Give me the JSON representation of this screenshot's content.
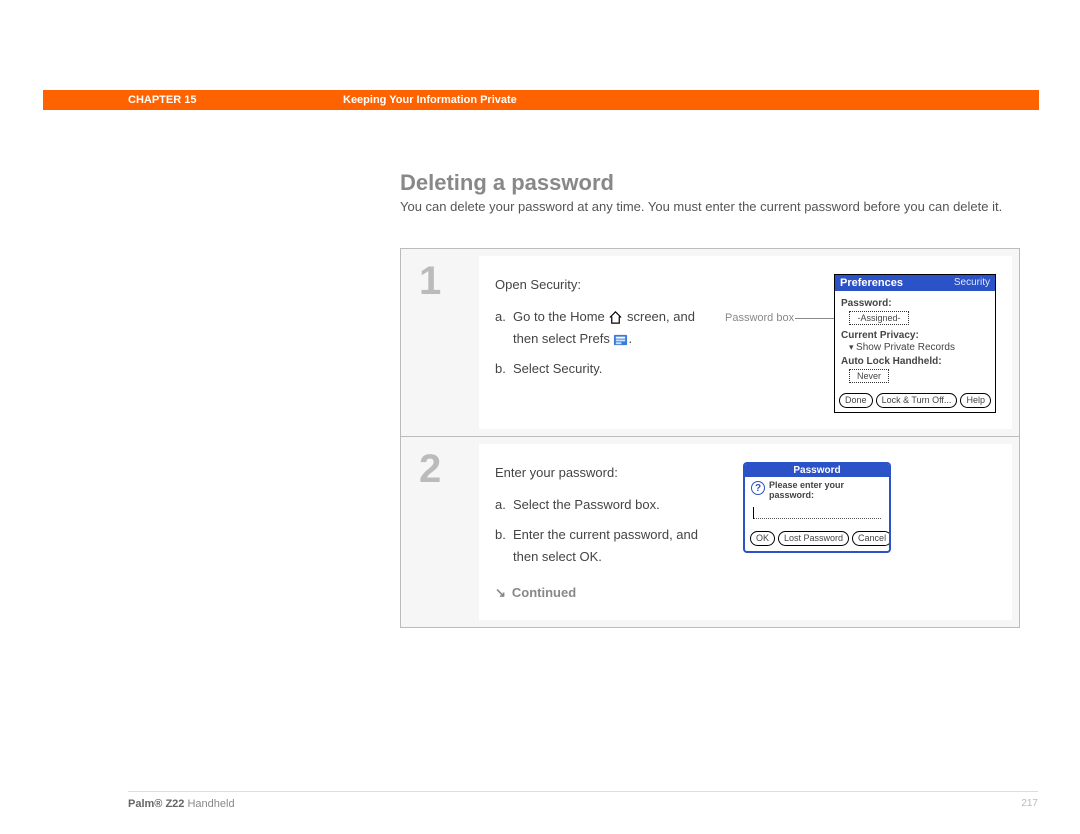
{
  "header": {
    "chapter": "CHAPTER 15",
    "title": "Keeping Your Information Private"
  },
  "section": {
    "heading": "Deleting a password",
    "intro": "You can delete your password at any time. You must enter the current password before you can delete it."
  },
  "steps": [
    {
      "num": "1",
      "lead": "Open Security:",
      "subs": [
        {
          "lbl": "a.",
          "txt_pre": "Go to the Home ",
          "txt_mid": " screen, and then select Prefs ",
          "txt_post": "."
        },
        {
          "lbl": "b.",
          "txt": "Select Security."
        }
      ],
      "callout": "Password box",
      "palm_prefs": {
        "title_left": "Preferences",
        "title_right": "Security",
        "password_label": "Password:",
        "password_value": "-Assigned-",
        "privacy_label": "Current Privacy:",
        "privacy_value": "Show Private Records",
        "autolock_label": "Auto Lock Handheld:",
        "autolock_value": "Never",
        "btn_done": "Done",
        "btn_lock": "Lock & Turn Off...",
        "btn_help": "Help"
      }
    },
    {
      "num": "2",
      "lead": "Enter your password:",
      "subs": [
        {
          "lbl": "a.",
          "txt": "Select the Password box."
        },
        {
          "lbl": "b.",
          "txt": "Enter the current password, and then select OK."
        }
      ],
      "continued": "Continued",
      "palm_dialog": {
        "title": "Password",
        "msg": "Please enter your password:",
        "btn_ok": "OK",
        "btn_lost": "Lost Password",
        "btn_cancel": "Cancel"
      }
    }
  ],
  "footer": {
    "product_bold": "Palm® Z22",
    "product_rest": " Handheld",
    "page": "217"
  }
}
